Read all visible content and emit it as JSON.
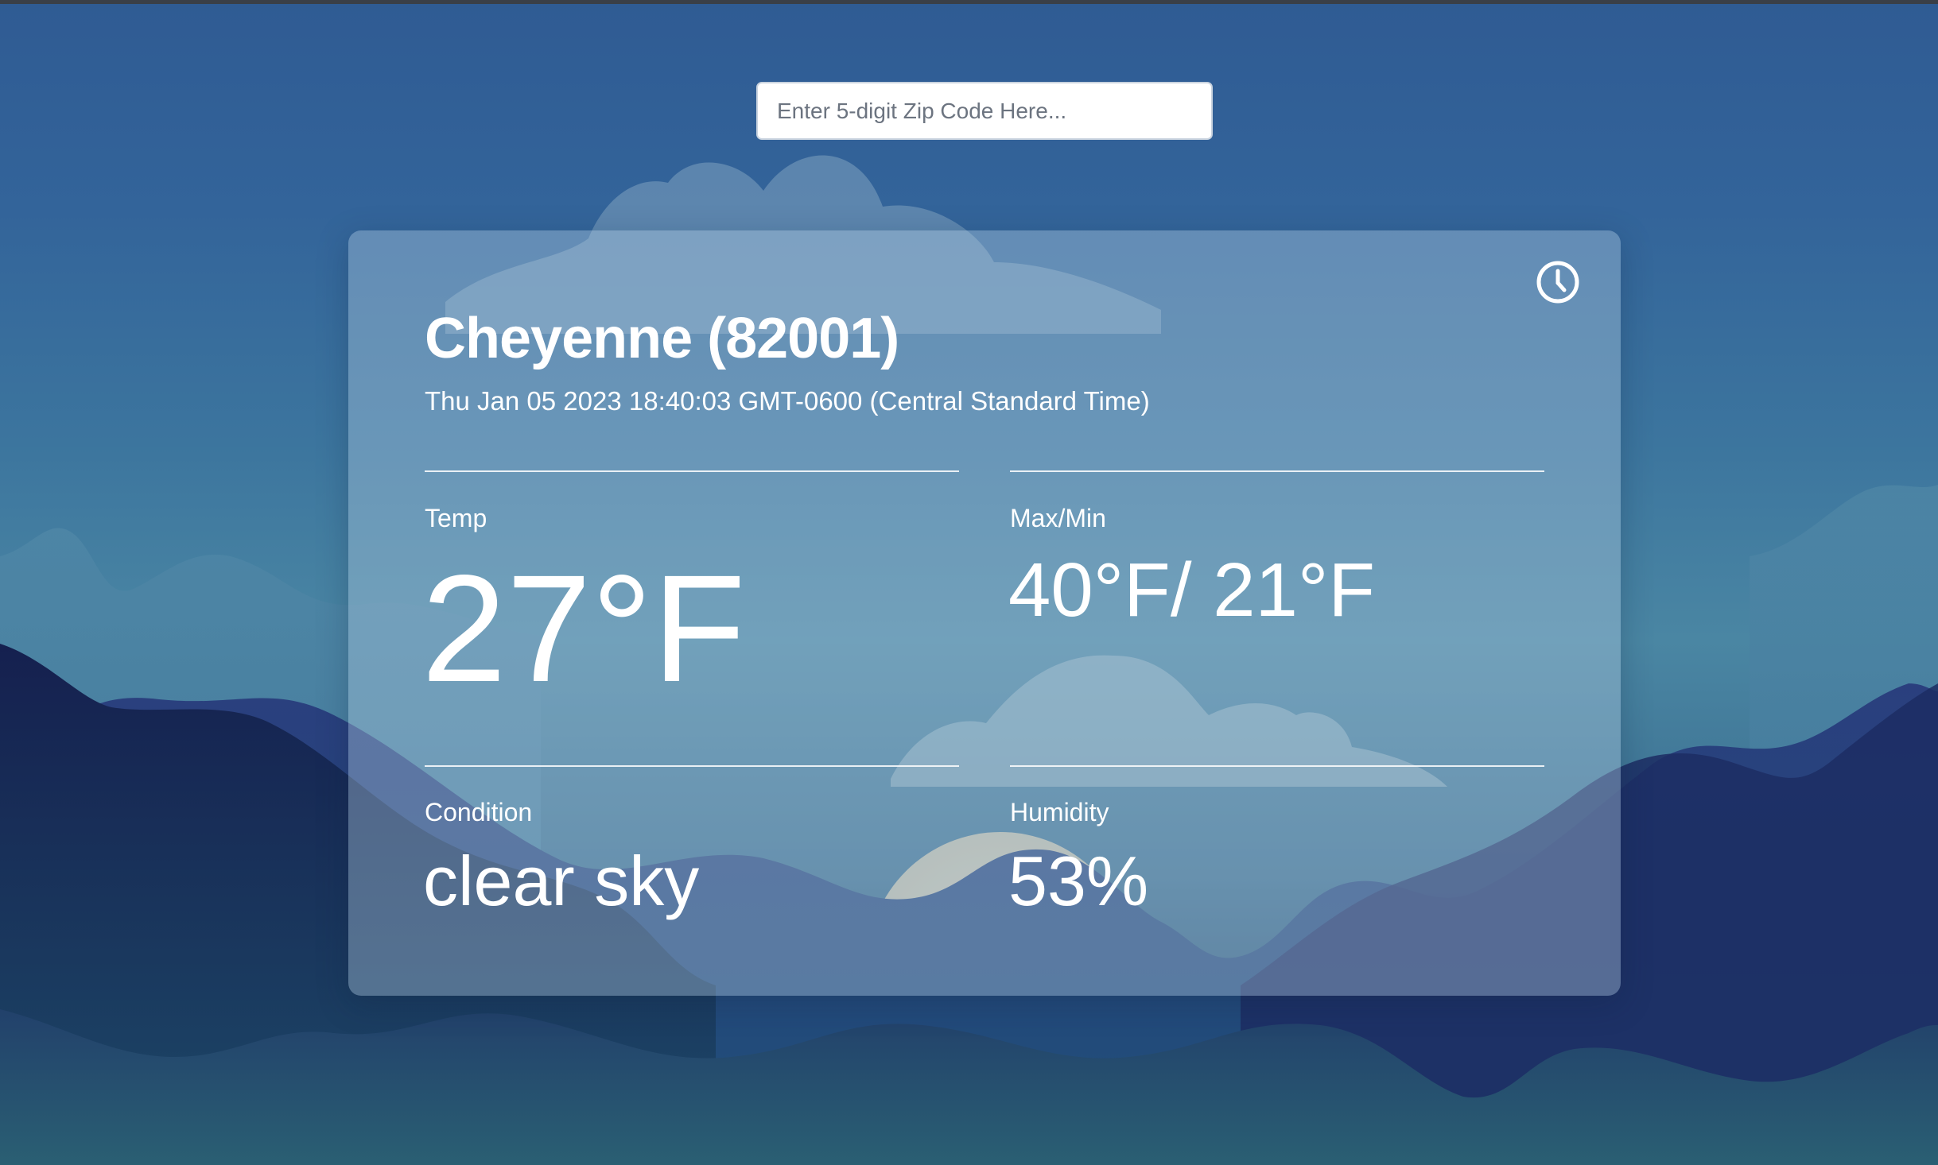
{
  "search": {
    "placeholder": "Enter 5-digit Zip Code Here...",
    "value": ""
  },
  "weather": {
    "city_title": "Cheyenne (82001)",
    "date_time": "Thu Jan 05 2023 18:40:03 GMT-0600 (Central Standard Time)",
    "temp_label": "Temp",
    "temp_value": "27°F",
    "maxmin_label": "Max/Min",
    "maxmin_value": "40°F/ 21°F",
    "condition_label": "Condition",
    "condition_value": "clear sky",
    "humidity_label": "Humidity",
    "humidity_value": "53%"
  },
  "icons": {
    "history": "clock-icon"
  },
  "colors": {
    "card_text": "#ffffff",
    "sky_top": "#2f5b93",
    "mountain_dark": "#1b2a5c"
  }
}
